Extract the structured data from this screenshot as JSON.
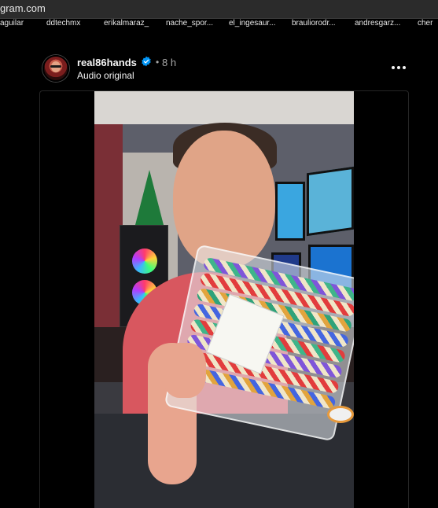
{
  "browser": {
    "url": "gram.com"
  },
  "stories": [
    {
      "name": "aguilar"
    },
    {
      "name": "ddtechmx"
    },
    {
      "name": "erikalmaraz_"
    },
    {
      "name": "nache_spor..."
    },
    {
      "name": "el_ingesaur..."
    },
    {
      "name": "brauliorodr..."
    },
    {
      "name": "andresgarz..."
    },
    {
      "name": "cher"
    }
  ],
  "post": {
    "username": "real86hands",
    "verified": true,
    "separator": "•",
    "time": "8 h",
    "audio_label": "Audio original",
    "more_icon": "more-horizontal-icon",
    "media_type": "video"
  },
  "colors": {
    "background": "#000000",
    "verified_badge": "#0095f6",
    "secondary_text": "#a8a8a8"
  }
}
